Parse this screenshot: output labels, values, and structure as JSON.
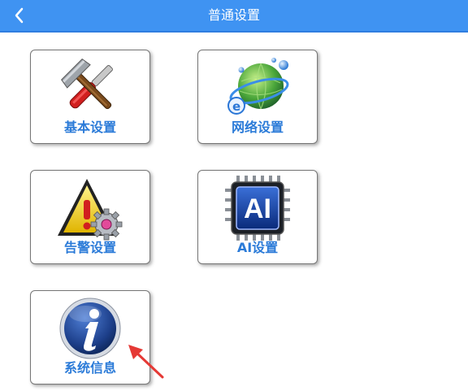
{
  "header": {
    "title": "普通设置",
    "back_icon": "chevron-left-icon",
    "color": "#3f93f2"
  },
  "tiles": [
    {
      "label": "基本设置",
      "icon": "tools-icon"
    },
    {
      "label": "网络设置",
      "icon": "globe-network-icon"
    },
    {
      "label": "告警设置",
      "icon": "warning-gear-icon"
    },
    {
      "label": "AI设置",
      "icon": "ai-chip-icon"
    },
    {
      "label": "系统信息",
      "icon": "info-icon"
    }
  ],
  "annotation": {
    "icon": "red-arrow-icon",
    "color": "#e53935"
  },
  "accent_color": "#2b7bd8"
}
